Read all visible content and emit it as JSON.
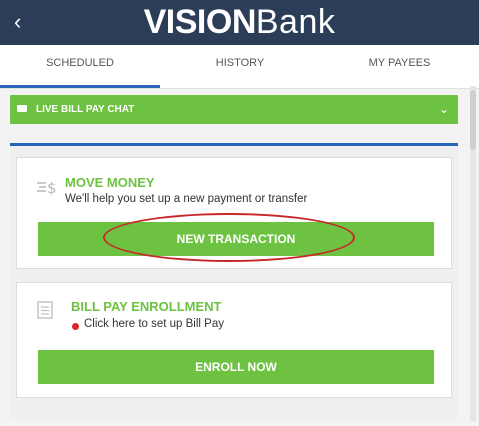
{
  "header": {
    "back_glyph": "‹",
    "brand_bold": "VISION",
    "brand_light": "Bank"
  },
  "tabs": [
    {
      "label": "SCHEDULED",
      "active": true
    },
    {
      "label": "HISTORY",
      "active": false
    },
    {
      "label": "MY PAYEES",
      "active": false
    }
  ],
  "chat": {
    "label": "LIVE BILL PAY CHAT",
    "chevron": "⌄"
  },
  "move_money": {
    "icon": "transfer-icon",
    "title": "MOVE MONEY",
    "subtitle": "We'll help you set up a new payment or transfer",
    "button": "NEW TRANSACTION"
  },
  "enrollment": {
    "icon": "document-icon",
    "title": "BILL PAY ENROLLMENT",
    "subtitle": "Click here to set up Bill Pay",
    "button": "ENROLL NOW"
  },
  "colors": {
    "header_bg": "#2c3e57",
    "accent_green": "#6dc242",
    "accent_blue": "#2a64b8",
    "dot_red": "#d9262c",
    "annotation_red": "#c62828"
  }
}
